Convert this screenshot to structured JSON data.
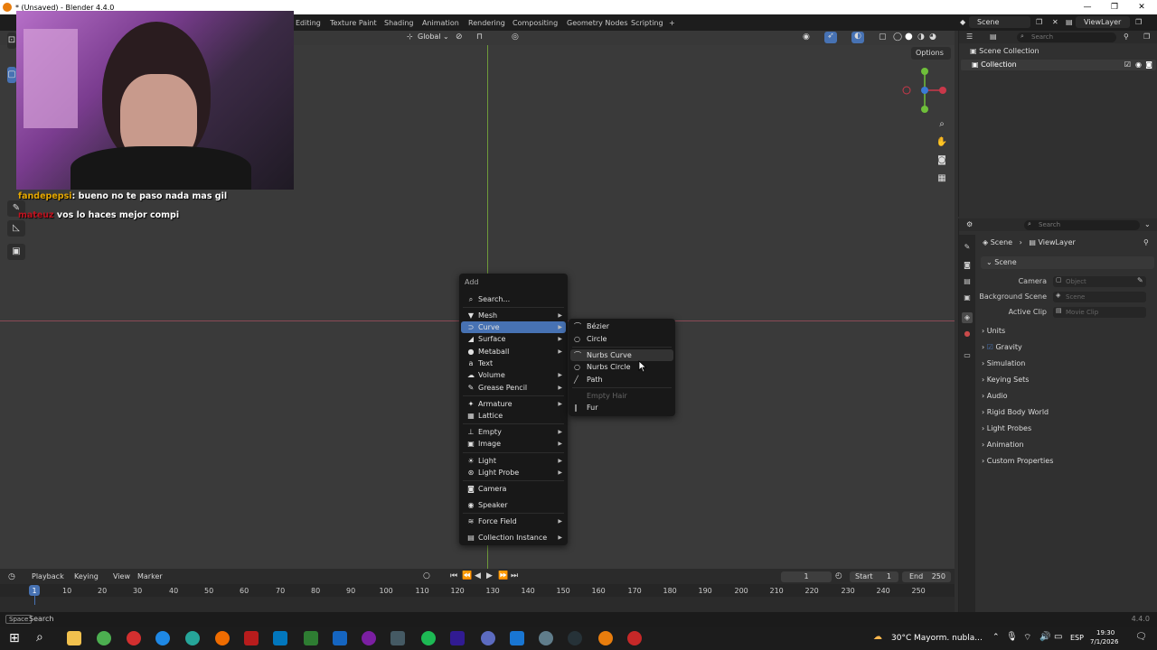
{
  "window": {
    "title": "* (Unsaved) - Blender 4.4.0",
    "minimize": "—",
    "maximize": "❐",
    "close": "✕"
  },
  "workspaces": [
    "Editing",
    "Texture Paint",
    "Shading",
    "Animation",
    "Rendering",
    "Compositing",
    "Geometry Nodes",
    "Scripting",
    "+"
  ],
  "header": {
    "scene": "Scene",
    "view_layer": "ViewLayer",
    "transform_orientation": "Global",
    "options": "Options"
  },
  "chat": [
    {
      "user": "fandepepsi",
      "sep": ":",
      "message": "bueno no te paso nada mas gil"
    },
    {
      "user": "mateuz",
      "message": "vos lo haces mejor compi"
    }
  ],
  "add_menu": {
    "title": "Add",
    "items": [
      {
        "label": "Search...",
        "icon": "search-icon",
        "glyph": "⌕"
      },
      {
        "label": "Mesh",
        "icon": "mesh-icon",
        "glyph": "▼",
        "arrow": "▶"
      },
      {
        "label": "Curve",
        "icon": "curve-icon",
        "glyph": "⊃",
        "arrow": "▶",
        "active": true
      },
      {
        "label": "Surface",
        "icon": "surface-icon",
        "glyph": "◢",
        "arrow": "▶"
      },
      {
        "label": "Metaball",
        "icon": "metaball-icon",
        "glyph": "●",
        "arrow": "▶"
      },
      {
        "label": "Text",
        "icon": "text-icon",
        "glyph": "a"
      },
      {
        "label": "Volume",
        "icon": "volume-icon",
        "glyph": "☁",
        "arrow": "▶"
      },
      {
        "label": "Grease Pencil",
        "icon": "grease-pencil-icon",
        "glyph": "✎",
        "arrow": "▶"
      },
      {
        "label": "Armature",
        "icon": "armature-icon",
        "glyph": "✦",
        "arrow": "▶"
      },
      {
        "label": "Lattice",
        "icon": "lattice-icon",
        "glyph": "▦"
      },
      {
        "label": "Empty",
        "icon": "empty-icon",
        "glyph": "⊥",
        "arrow": "▶"
      },
      {
        "label": "Image",
        "icon": "image-icon",
        "glyph": "▣",
        "arrow": "▶"
      },
      {
        "label": "Light",
        "icon": "light-icon",
        "glyph": "☀",
        "arrow": "▶"
      },
      {
        "label": "Light Probe",
        "icon": "light-probe-icon",
        "glyph": "⊛",
        "arrow": "▶"
      },
      {
        "label": "Camera",
        "icon": "camera-icon",
        "glyph": "◙"
      },
      {
        "label": "Speaker",
        "icon": "speaker-icon",
        "glyph": "◉"
      },
      {
        "label": "Force Field",
        "icon": "force-field-icon",
        "glyph": "≋",
        "arrow": "▶"
      },
      {
        "label": "Collection Instance",
        "icon": "collection-instance-icon",
        "glyph": "▤",
        "arrow": "▶"
      }
    ]
  },
  "curve_menu": {
    "items": [
      {
        "label": "Bézier",
        "icon": "bezier-icon",
        "glyph": "⌒"
      },
      {
        "label": "Circle",
        "icon": "circle-icon",
        "glyph": "○"
      },
      {
        "label": "Nurbs Curve",
        "icon": "nurbs-curve-icon",
        "glyph": "⌒",
        "hover": true
      },
      {
        "label": "Nurbs Circle",
        "icon": "nurbs-circle-icon",
        "glyph": "○"
      },
      {
        "label": "Path",
        "icon": "path-icon",
        "glyph": "╱"
      },
      {
        "label": "Empty Hair",
        "icon": "",
        "glyph": "",
        "disabled": true
      },
      {
        "label": "Fur",
        "icon": "fur-icon",
        "glyph": "∥"
      }
    ]
  },
  "outliner": {
    "search_placeholder": "Search",
    "scene_collection": "Scene Collection",
    "collection": "Collection"
  },
  "properties": {
    "search_placeholder": "Search",
    "breadcrumb_scene": "Scene",
    "breadcrumb_viewlayer": "ViewLayer",
    "panel_scene": "Scene",
    "camera_label": "Camera",
    "camera_placeholder": "Object",
    "background_label": "Background Scene",
    "background_placeholder": "Scene",
    "active_clip_label": "Active Clip",
    "active_clip_placeholder": "Movie Clip",
    "panels": [
      "Units",
      "Gravity",
      "Simulation",
      "Keying Sets",
      "Audio",
      "Rigid Body World",
      "Light Probes",
      "Animation",
      "Custom Properties"
    ]
  },
  "timeline": {
    "menus": [
      "Playback",
      "Keying",
      "View",
      "Marker"
    ],
    "current_frame": "1",
    "start_label": "Start",
    "start": "1",
    "end_label": "End",
    "end": "250",
    "ruler": [
      "1",
      "10",
      "20",
      "30",
      "40",
      "50",
      "60",
      "70",
      "80",
      "90",
      "100",
      "110",
      "120",
      "130",
      "140",
      "150",
      "160",
      "170",
      "180",
      "190",
      "200",
      "210",
      "220",
      "230",
      "240",
      "250"
    ]
  },
  "statusbar": {
    "key": "Space",
    "action": "Search",
    "version": "4.4.0"
  },
  "taskbar": {
    "weather": "30°C",
    "weather_desc": "Mayorm. nubla...",
    "lang": "ESP",
    "time": "19:30",
    "date": "7/1/2026"
  }
}
